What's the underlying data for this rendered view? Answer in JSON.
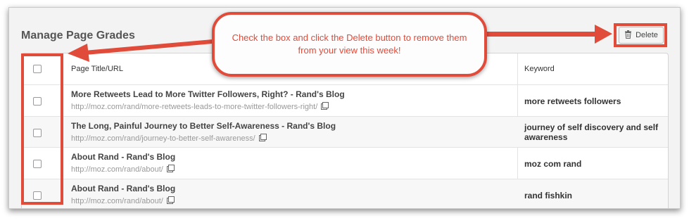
{
  "page": {
    "title": "Manage Page Grades",
    "delete_label": "Delete"
  },
  "table": {
    "headers": {
      "title_url": "Page Title/URL",
      "keyword": "Keyword"
    },
    "rows": [
      {
        "title": "More Retweets Lead to More Twitter Followers, Right? - Rand's Blog",
        "url": "http://moz.com/rand/more-retweets-leads-to-more-twitter-followers-right/",
        "keyword": "more retweets followers"
      },
      {
        "title": "The Long, Painful Journey to Better Self-Awareness - Rand's Blog",
        "url": "http://moz.com/rand/journey-to-better-self-awareness/",
        "keyword": "journey of self discovery and self awareness"
      },
      {
        "title": "About Rand - Rand's Blog",
        "url": "http://moz.com/rand/about/",
        "keyword": "moz com rand"
      },
      {
        "title": "About Rand - Rand's Blog",
        "url": "http://moz.com/rand/about/",
        "keyword": "rand fishkin"
      }
    ]
  },
  "annotation": {
    "callout_text": "Check the box and click the Delete button to remove them from your view this week!",
    "color": "#e04b3a"
  },
  "icons": {
    "delete": "trash-icon",
    "external_link": "external-link-icon",
    "checkbox": "checkbox-icon"
  }
}
